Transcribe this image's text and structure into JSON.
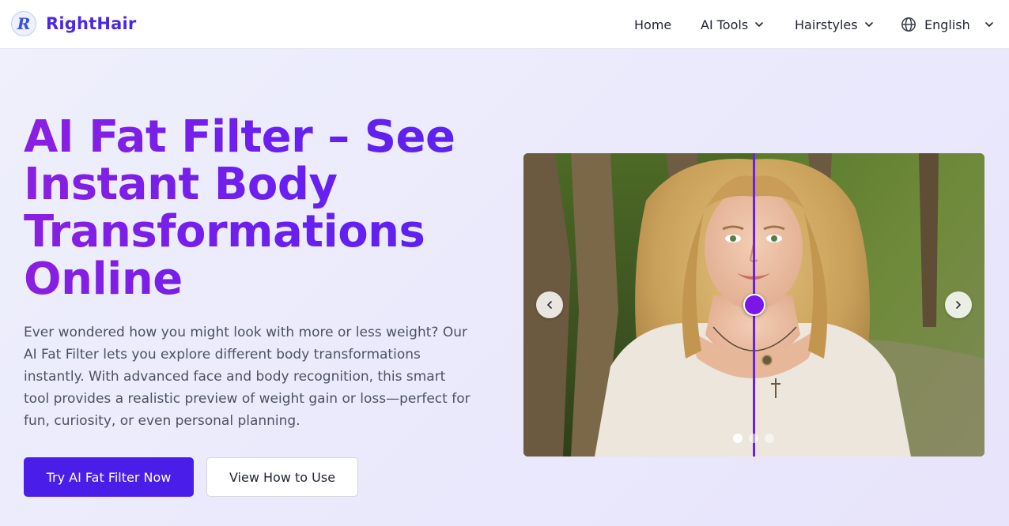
{
  "brand": {
    "logo_letter": "R",
    "name": "RightHair",
    "accent": "#4a2ae0"
  },
  "nav": {
    "home": "Home",
    "ai_tools": "AI Tools",
    "hairstyles": "Hairstyles",
    "language": "English"
  },
  "hero": {
    "title": "AI Fat Filter – See Instant Body Transformations Online",
    "description": "Ever wondered how you might look with more or less weight? Our AI Fat Filter lets you explore different body transformations instantly. With advanced face and body recognition, this smart tool provides a realistic preview of weight gain or loss—perfect for fun, curiosity, or even personal planning.",
    "primary_button": "Try AI Fat Filter Now",
    "secondary_button": "View How to Use"
  },
  "carousel": {
    "slide_count": 3,
    "active_slide": 1,
    "comparison_position_percent": 50,
    "accent": "#6a1ff0"
  },
  "icons": {
    "logo": "r-logo-icon",
    "chevron": "chevron-down-icon",
    "globe": "globe-icon",
    "prev": "chevron-left-icon",
    "next": "chevron-right-icon"
  }
}
